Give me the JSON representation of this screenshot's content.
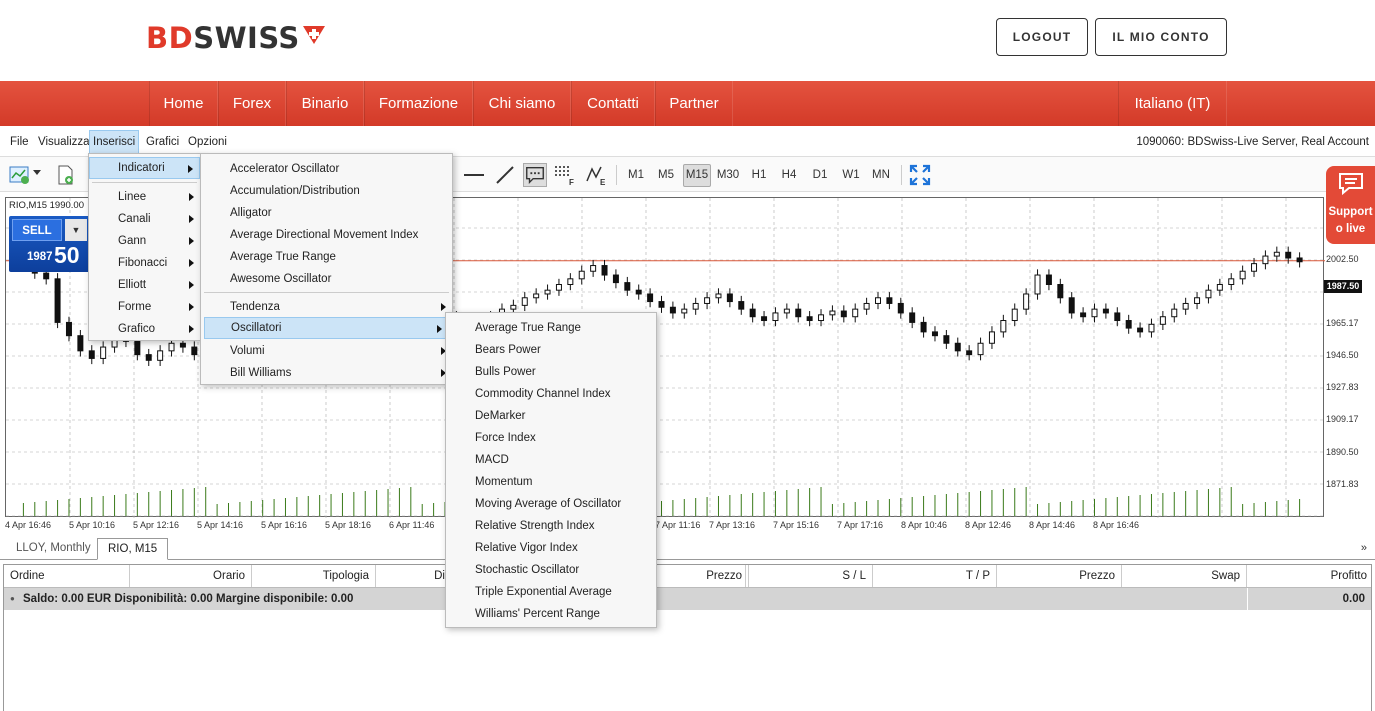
{
  "brand": {
    "part1": "BD",
    "part2": "SWISS",
    "red": "#e03a2a",
    "dark": "#333333"
  },
  "header_buttons": {
    "logout": "LOGOUT",
    "account": "IL MIO CONTO"
  },
  "nav": {
    "items": [
      "Home",
      "Forex",
      "Binario",
      "Formazione",
      "Chi siamo",
      "Contatti",
      "Partner"
    ],
    "language": "Italiano (IT)",
    "color": "#d9432f"
  },
  "menubar": {
    "items": [
      "File",
      "Visualizza",
      "Inserisci",
      "Grafici",
      "Opzioni"
    ],
    "active": "Inserisci",
    "account_info": "1090060: BDSwiss-Live Server, Real Account"
  },
  "toolbar": {
    "timeframes": [
      "M1",
      "M5",
      "M15",
      "M30",
      "H1",
      "H4",
      "D1",
      "W1",
      "MN"
    ],
    "active_timeframe": "M15"
  },
  "chart": {
    "title": "RIO,M15  1990.00",
    "current_price": "1987.50"
  },
  "trade": {
    "sell_label": "SELL",
    "price_small": "1987",
    "price_big": "50"
  },
  "support": {
    "line1": "Support",
    "line2": "o live"
  },
  "chart_data": {
    "type": "candlestick",
    "y_ticks": [
      "2002.50",
      "1965.17",
      "1946.50",
      "1927.83",
      "1909.17",
      "1890.50",
      "1871.83"
    ],
    "x_ticks": [
      "4 Apr 16:46",
      "5 Apr 10:16",
      "5 Apr 12:16",
      "5 Apr 14:16",
      "5 Apr 16:16",
      "5 Apr 18:16",
      "6 Apr 11:46",
      "7 Apr 11:16",
      "7 Apr 13:16",
      "7 Apr 15:16",
      "7 Apr 17:16",
      "8 Apr 10:46",
      "8 Apr 12:46",
      "8 Apr 14:46",
      "8 Apr 16:46"
    ],
    "last_price": 1987.5
  },
  "tabs": {
    "items": [
      "LLOY, Monthly",
      "RIO, M15"
    ],
    "active": "RIO, M15",
    "more": "»"
  },
  "orders": {
    "columns": [
      "Ordine",
      "Orario",
      "Tipologia",
      "Di",
      "Prezzo",
      "S / L",
      "T / P",
      "Prezzo",
      "Swap",
      "Profitto"
    ],
    "balance_text": "Saldo: 0.00 EUR  Disponibilità: 0.00  Margine disponibile: 0.00",
    "profit_total": "0.00"
  },
  "menu_inserisci": {
    "items": [
      "Indicatori",
      "Linee",
      "Canali",
      "Gann",
      "Fibonacci",
      "Elliott",
      "Forme",
      "Grafico"
    ],
    "active": "Indicatori"
  },
  "menu_indicatori": {
    "group1": [
      "Accelerator Oscillator",
      "Accumulation/Distribution",
      "Alligator",
      "Average Directional Movement Index",
      "Average True Range",
      "Awesome Oscillator"
    ],
    "group2": [
      "Tendenza",
      "Oscillatori",
      "Volumi",
      "Bill Williams"
    ],
    "active": "Oscillatori"
  },
  "menu_oscillatori": {
    "items": [
      "Average True Range",
      "Bears Power",
      "Bulls Power",
      "Commodity Channel Index",
      "DeMarker",
      "Force Index",
      "MACD",
      "Momentum",
      "Moving Average of Oscillator",
      "Relative Strength Index",
      "Relative Vigor Index",
      "Stochastic Oscillator",
      "Triple Exponential Average",
      "Williams' Percent Range"
    ]
  }
}
